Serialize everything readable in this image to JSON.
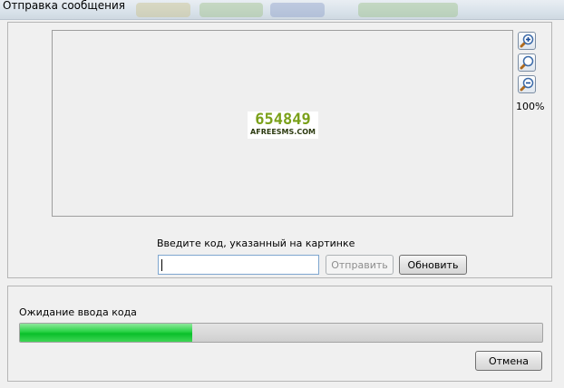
{
  "window": {
    "title": "Отправка сообщения"
  },
  "captcha": {
    "code": "654849",
    "site": "AFREESMS.COM"
  },
  "zoom": {
    "zoom_in_icon": "zoom-in-icon",
    "zoom_reset_icon": "zoom-reset-icon",
    "zoom_out_icon": "zoom-out-icon",
    "level": "100%"
  },
  "form": {
    "label": "Введите код, указанный на картинке",
    "input_value": "",
    "send_label": "Отправить",
    "refresh_label": "Обновить"
  },
  "status": {
    "text": "Ожидание ввода кода",
    "progress": 0.33,
    "progress_color": "#19c93a"
  },
  "footer": {
    "cancel_label": "Отмена"
  }
}
